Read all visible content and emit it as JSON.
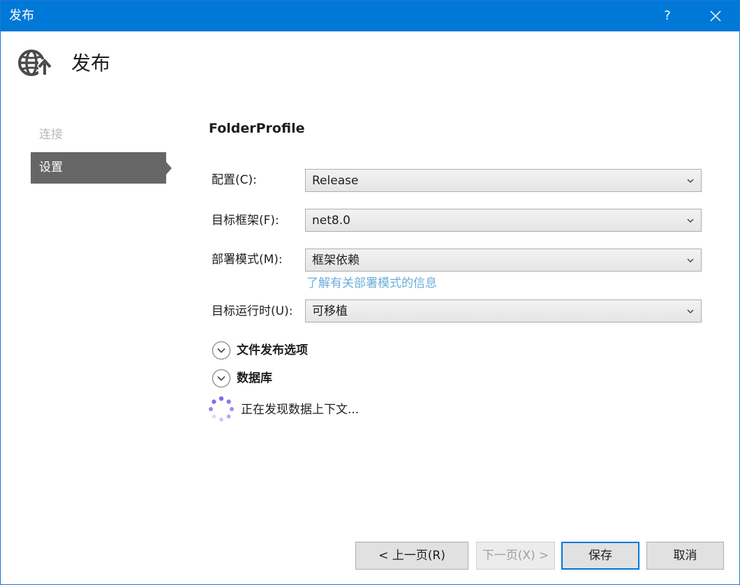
{
  "window": {
    "title": "发布",
    "help_glyph": "?"
  },
  "header": {
    "icon": "globe-publish-icon",
    "title": "发布"
  },
  "nav": {
    "items": [
      {
        "label": "连接",
        "state": "disabled"
      },
      {
        "label": "设置",
        "state": "selected"
      }
    ]
  },
  "main": {
    "profile_name": "FolderProfile",
    "fields": {
      "configuration": {
        "label": "配置(C):",
        "value": "Release"
      },
      "target_framework": {
        "label": "目标框架(F):",
        "value": "net8.0"
      },
      "deployment_mode": {
        "label": "部署模式(M):",
        "value": "框架依赖"
      },
      "target_runtime": {
        "label": "目标运行时(U):",
        "value": "可移植"
      }
    },
    "learn_more_link": "了解有关部署模式的信息",
    "sections": [
      {
        "label": "文件发布选项",
        "icon": "chevron-down-circle-icon"
      },
      {
        "label": "数据库",
        "icon": "chevron-down-circle-icon"
      }
    ],
    "loading_text": "正在发现数据上下文..."
  },
  "footer": {
    "prev_label": "< 上一页(R)",
    "next_label": "下一页(X) >",
    "save_label": "保存",
    "cancel_label": "取消"
  },
  "colors": {
    "titlebar": "#0078d7",
    "nav_selected": "#666666",
    "link": "#6aaed9",
    "spinner": "#7b68ee"
  }
}
